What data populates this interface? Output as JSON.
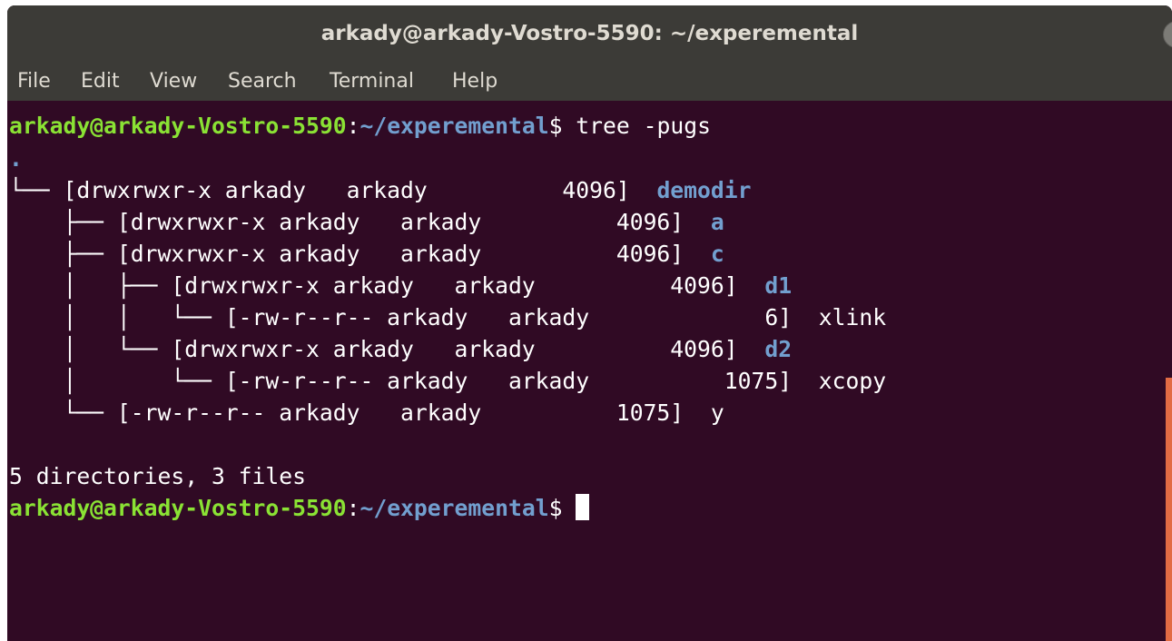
{
  "window": {
    "title": "arkady@arkady-Vostro-5590: ~/experemental",
    "buttons": {
      "minimize_icon": "minimize-icon",
      "maximize_icon": "maximize-icon",
      "close_icon": "close-icon"
    }
  },
  "menu": [
    "File",
    "Edit",
    "View",
    "Search",
    "Terminal",
    "Help"
  ],
  "prompt": {
    "user_host": "arkady@arkady-Vostro-5590",
    "separator": ":",
    "path": "~/experemental",
    "symbol": "$ "
  },
  "command": "tree -pugs",
  "tree": {
    "root": ".",
    "entries": [
      {
        "prefix": "└── ",
        "info": "[drwxrwxr-x arkady   arkady          4096]  ",
        "name": "demodir",
        "is_dir": true
      },
      {
        "prefix": "    ├── ",
        "info": "[drwxrwxr-x arkady   arkady          4096]  ",
        "name": "a",
        "is_dir": true
      },
      {
        "prefix": "    ├── ",
        "info": "[drwxrwxr-x arkady   arkady          4096]  ",
        "name": "c",
        "is_dir": true
      },
      {
        "prefix": "    │   ├── ",
        "info": "[drwxrwxr-x arkady   arkady          4096]  ",
        "name": "d1",
        "is_dir": true
      },
      {
        "prefix": "    │   │   └── ",
        "info": "[-rw-r--r-- arkady   arkady             6]  ",
        "name": "xlink",
        "is_dir": false
      },
      {
        "prefix": "    │   └── ",
        "info": "[drwxrwxr-x arkady   arkady          4096]  ",
        "name": "d2",
        "is_dir": true
      },
      {
        "prefix": "    │       └── ",
        "info": "[-rw-r--r-- arkady   arkady          1075]  ",
        "name": "xcopy",
        "is_dir": false
      },
      {
        "prefix": "    └── ",
        "info": "[-rw-r--r-- arkady   arkady          1075]  ",
        "name": "y",
        "is_dir": false
      }
    ]
  },
  "summary": "5 directories, 3 files",
  "colors": {
    "background": "#300a24",
    "user": "#8ae234",
    "path": "#729fcf",
    "text": "#ffffff",
    "titlebar": "#3c3b37",
    "close_button": "#e95420"
  }
}
